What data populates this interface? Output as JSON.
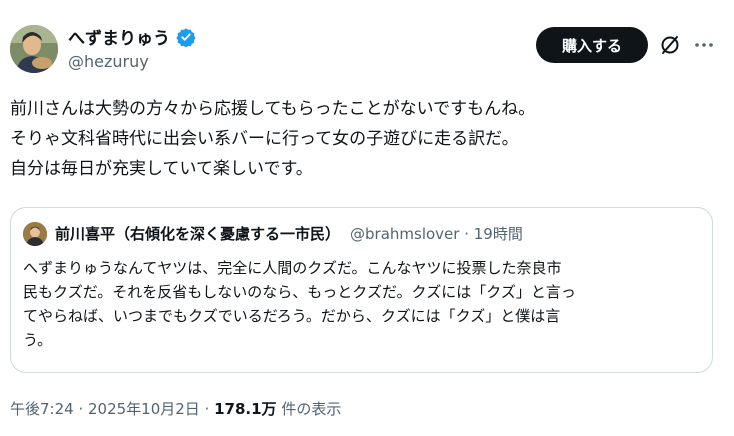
{
  "author": {
    "display_name": "へずまりゅう",
    "handle": "@hezuruy",
    "avatar_icon": "profile-photo",
    "verified_icon": "verified-badge-icon"
  },
  "actions": {
    "subscribe_label": "購入する",
    "grok_icon": "grok-icon",
    "more_icon": "more-icon"
  },
  "tweet": {
    "lines": [
      "前川さんは大勢の方々から応援してもらったことがないですもんね。",
      "そりゃ文科省時代に出会い系バーに行って女の子遊びに走る訳だ。",
      "自分は毎日が充実していて楽しいです。"
    ]
  },
  "quote": {
    "name": "前川喜平（右傾化を深く憂慮する一市民）",
    "meta": "@brahmslover · 19時間",
    "lines": [
      "へずまりゅうなんてヤツは、完全に人間のクズだ。こんなヤツに投票した奈良市",
      "民もクズだ。それを反省もしないのなら、もっとクズだ。クズには「クズ」と言っ",
      "てやらねば、いつまでもクズでいるだろう。だから、クズには「クズ」と僕は言",
      "う。"
    ]
  },
  "footer": {
    "timestamp": "午後7:24 · 2025年10月2日 · ",
    "views": "178.1万",
    "views_suffix": " 件の表示"
  },
  "colors": {
    "text": "#0f1419",
    "secondary": "#536471",
    "verified": "#1d9bf0",
    "border": "#cfd9de",
    "button_bg": "#0f1419"
  }
}
